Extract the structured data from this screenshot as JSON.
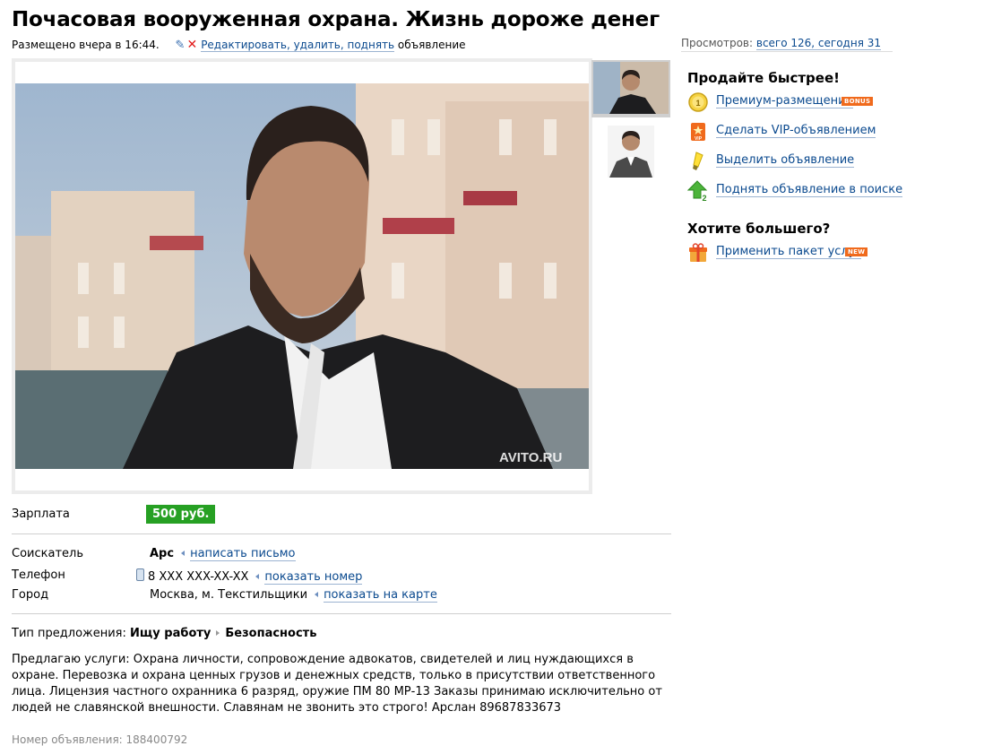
{
  "ad": {
    "title": "Почасовая вооруженная охрана. Жизнь дороже денег",
    "posted": "Размещено вчера в 16:44.",
    "edit_link": "Редактировать, удалить, поднять",
    "edit_suffix": "объявление"
  },
  "views": {
    "label": "Просмотров:",
    "link": "всего 126, сегодня 31"
  },
  "photo": {
    "watermark": "AVITO.RU"
  },
  "details": {
    "salary_label": "Зарплата",
    "salary_value": "500 руб.",
    "applicant_label": "Соискатель",
    "applicant_name": "Арс",
    "write_letter": "написать письмо",
    "phone_label": "Телефон",
    "phone_value": "8 XXX XXX-XX-XX",
    "show_number": "показать номер",
    "city_label": "Город",
    "city_value": "Москва, м. Текстильщики",
    "show_map": "показать на карте",
    "offer_type_label": "Тип предложения:",
    "offer_type": "Ищу работу",
    "offer_category": "Безопасность"
  },
  "description": "Предлагаю услуги: Охрана личности, сопровождение адвокатов, свидетелей и лиц нуждающихся в охране. Перевозка и охрана ценных грузов и денежных средств, только в присутствии ответственного лица. Лицензия частного охранника 6 разряд, оружие ПМ 80 МР-13 Заказы принимаю исключительно от людей не славянской внешности. Славянам не звонить это строго! Арслан 89687833673",
  "ad_number": "Номер объявления: 188400792",
  "sidebar": {
    "sell_faster": "Продайте быстрее!",
    "items": [
      {
        "label": "Премиум-размещение",
        "badge": "BONUS",
        "icon": "coin-icon"
      },
      {
        "label": "Сделать VIP-объявлением",
        "icon": "vip-icon"
      },
      {
        "label": "Выделить объявление",
        "icon": "highlighter-icon"
      },
      {
        "label": "Поднять объявление в поиске",
        "icon": "arrow-up-icon"
      }
    ],
    "want_more": "Хотите большего?",
    "package": {
      "label": "Применить пакет услуг",
      "badge": "NEW",
      "icon": "gift-icon"
    }
  },
  "colors": {
    "link": "#0b4a8f",
    "salary_bg": "#26a023",
    "badge_bg": "#f06a1c",
    "delete_red": "#e21b1b"
  }
}
